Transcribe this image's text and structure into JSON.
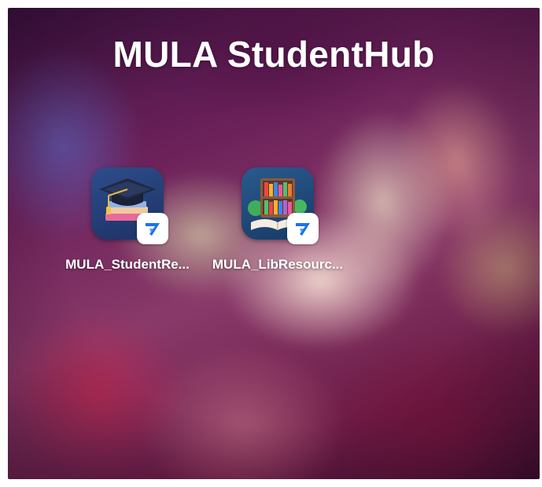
{
  "folder": {
    "title": "MULA StudentHub"
  },
  "apps": [
    {
      "label": "MULA_StudentRe...",
      "icon": "graduation-cap-books-icon",
      "badge_icon": "appsheet-badge-icon"
    },
    {
      "label": "MULA_LibResourc...",
      "icon": "library-bookshelf-icon",
      "badge_icon": "appsheet-badge-icon"
    }
  ],
  "colors": {
    "badge_blue": "#1a73e8",
    "text": "#ffffff"
  }
}
